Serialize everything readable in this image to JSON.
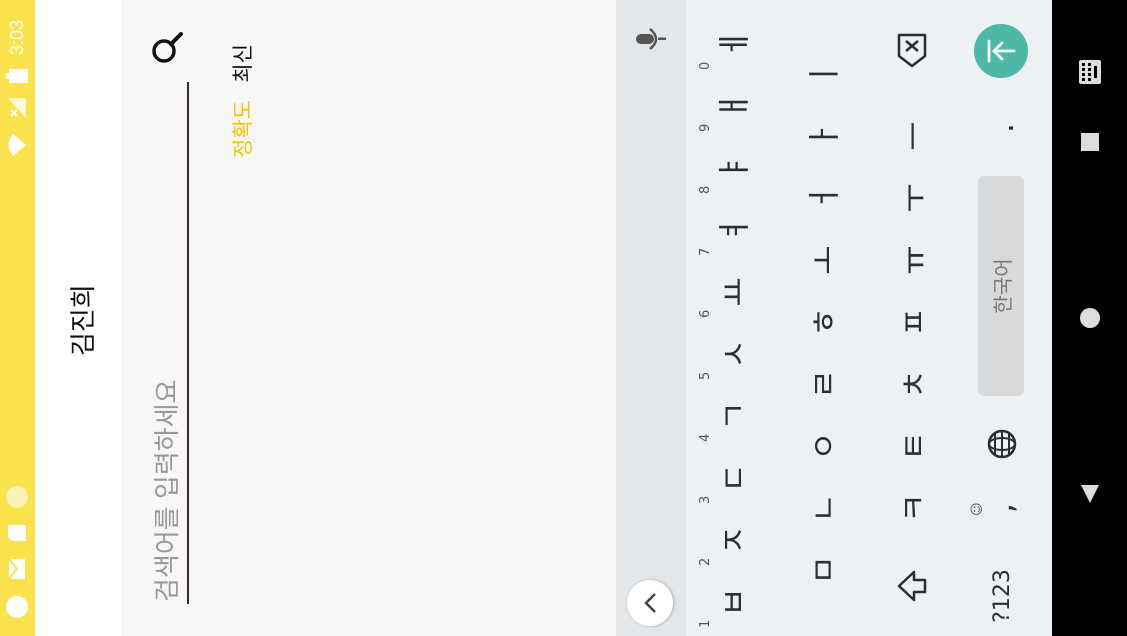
{
  "status_bar": {
    "time": "3:03",
    "icons": [
      "notification-dot-icon",
      "sd-card-icon",
      "mail-icon",
      "circle-icon",
      "battery-icon",
      "no-signal-icon",
      "wifi-icon"
    ]
  },
  "app_bar": {
    "title": "김진희"
  },
  "search": {
    "placeholder": "검색어를 입력하세요",
    "value": ""
  },
  "sort": {
    "accuracy": "정확도",
    "recent": "최신"
  },
  "colors": {
    "status": "#f9e24c",
    "accent": "#f5c400",
    "enter": "#4db8a7"
  },
  "keyboard": {
    "hints": [
      "1",
      "2",
      "3",
      "4",
      "5",
      "6",
      "7",
      "8",
      "9",
      "0"
    ],
    "row1": [
      "ㅂ",
      "ㅈ",
      "ㄷ",
      "ㄱ",
      "ㅅ",
      "ㅛ",
      "ㅕ",
      "ㅑ",
      "ㅐ",
      "ㅔ"
    ],
    "row2": [
      "ㅁ",
      "ㄴ",
      "ㅇ",
      "ㄹ",
      "ㅎ",
      "ㅗ",
      "ㅓ",
      "ㅏ",
      "ㅣ"
    ],
    "row3": [
      "ㅋ",
      "ㅌ",
      "ㅊ",
      "ㅍ",
      "ㅠ",
      "ㅜ",
      "ㅡ"
    ],
    "symbols_label": "?123",
    "comma_label": ",",
    "space_label": "한국어",
    "period_label": "."
  }
}
